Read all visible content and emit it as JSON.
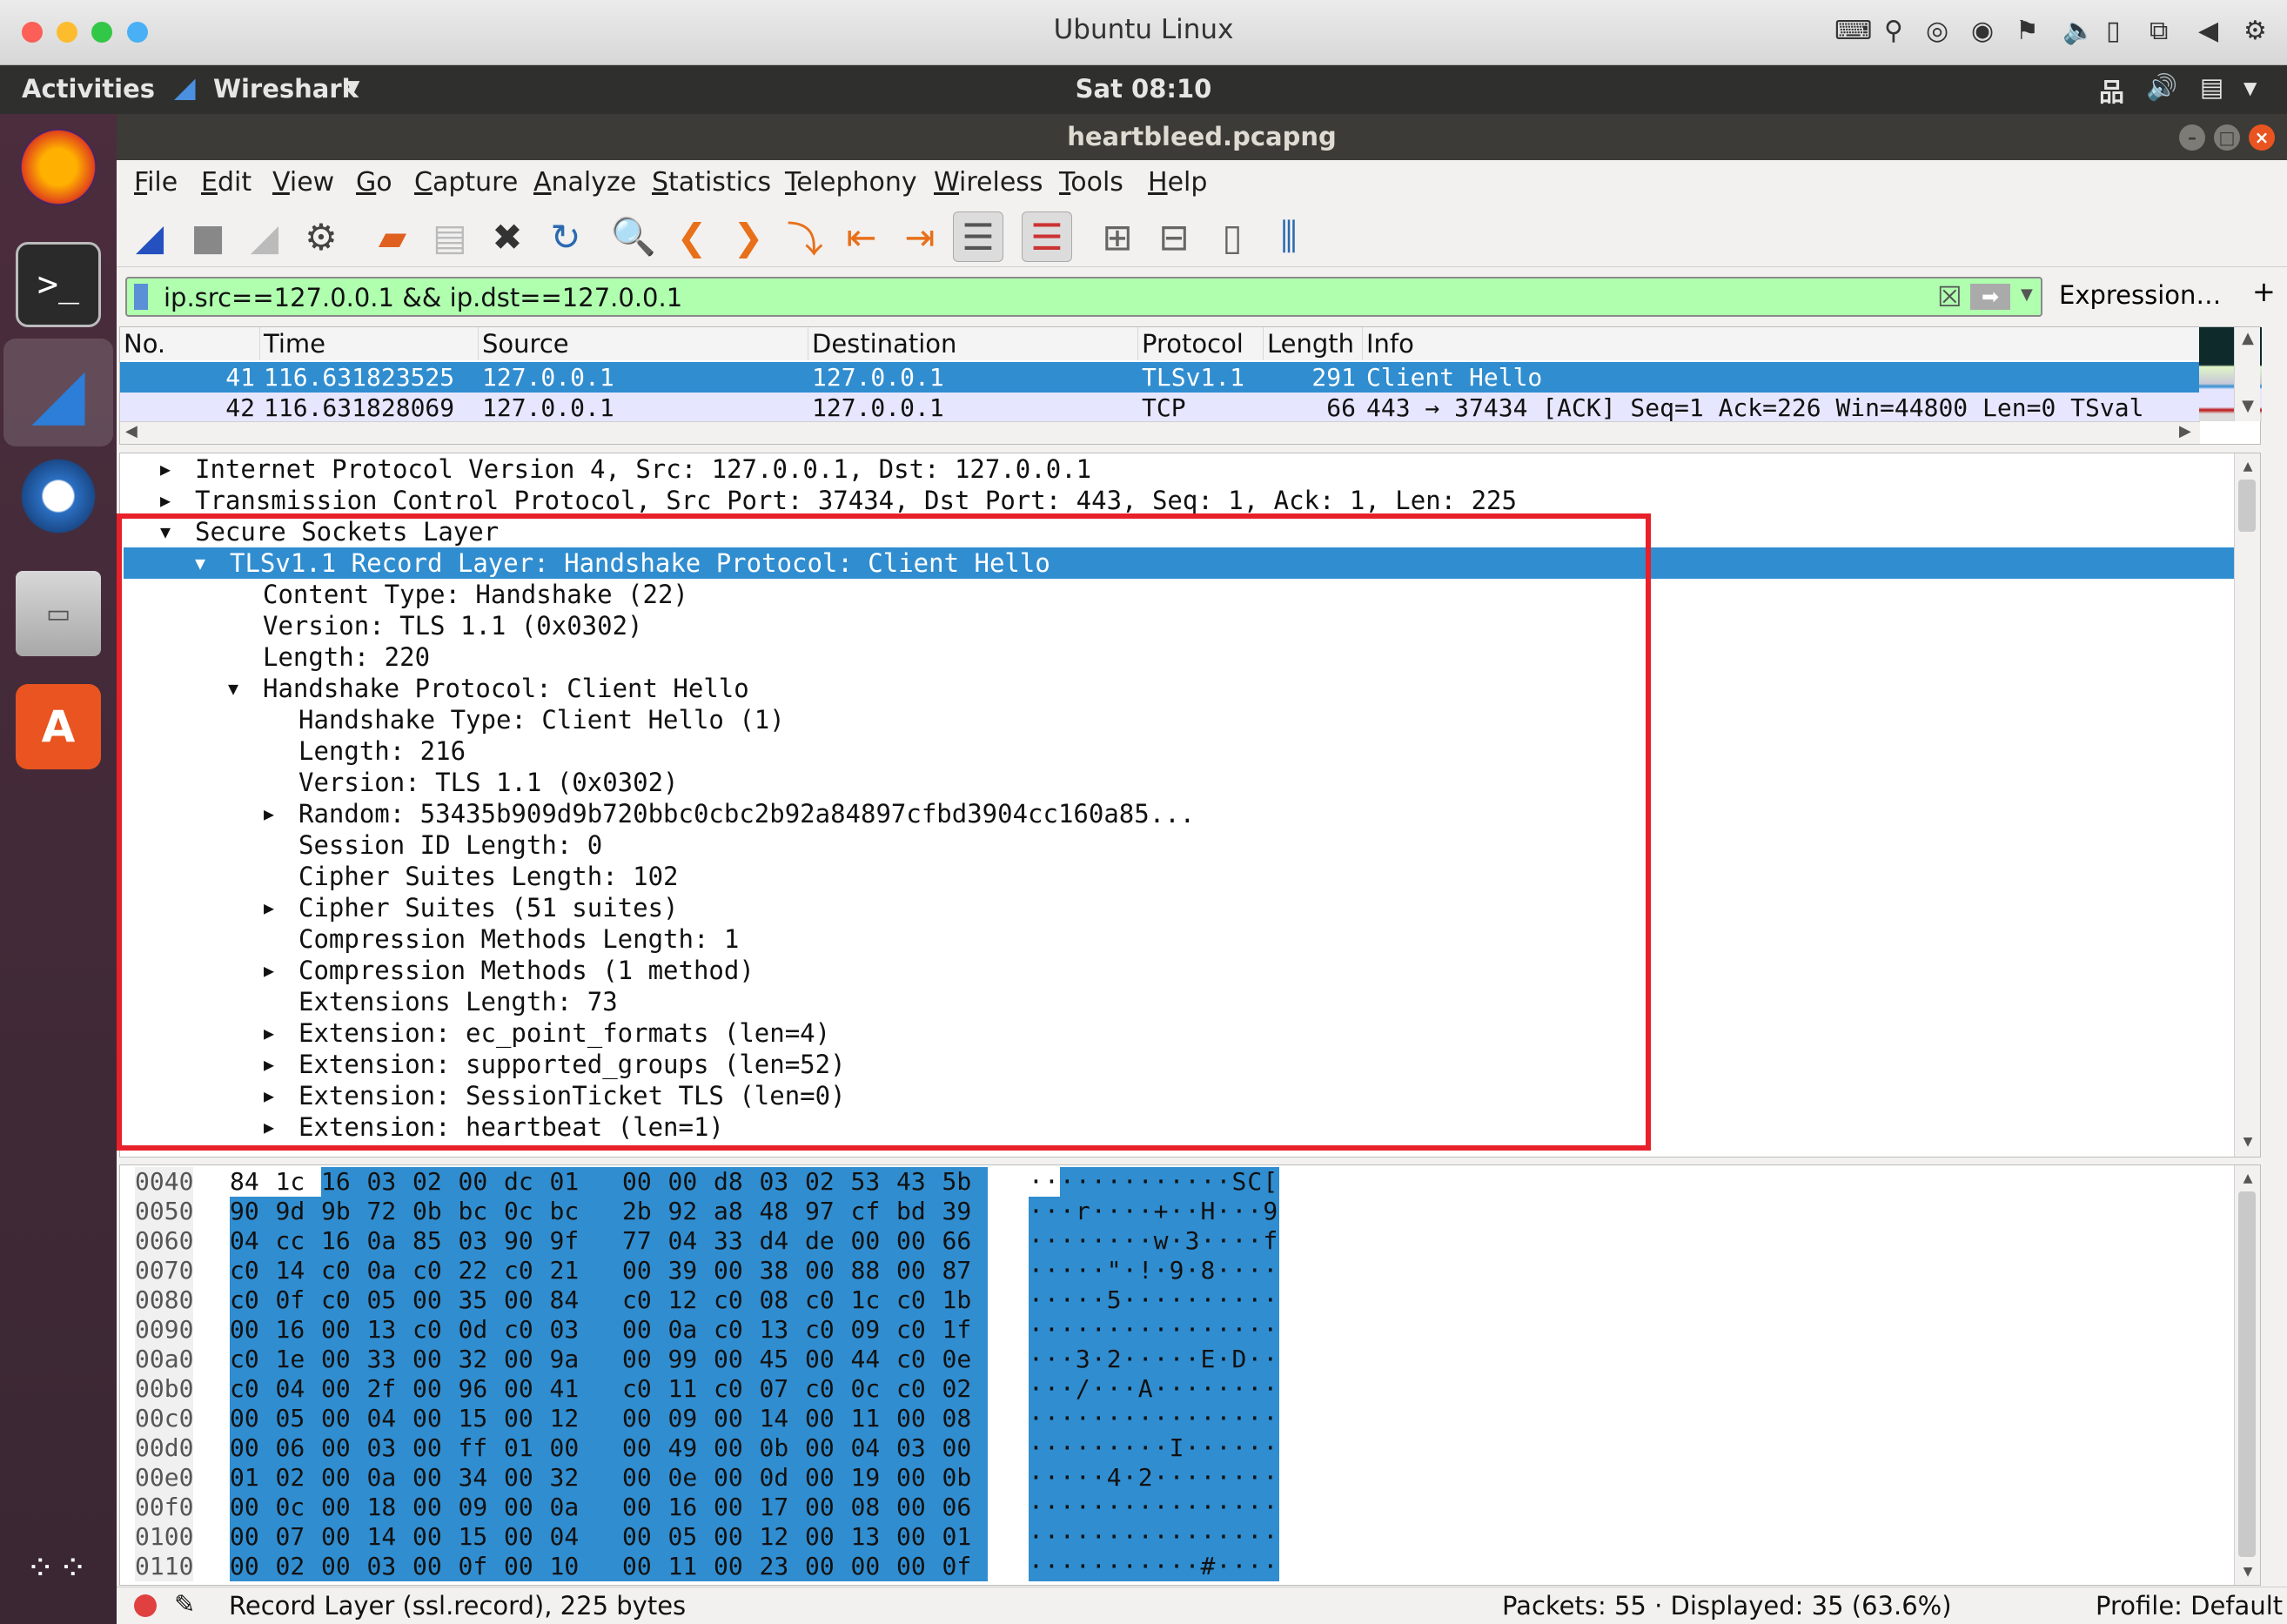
{
  "mac_window": {
    "title": "Ubuntu Linux",
    "traffic_lights": [
      "#fc5f57",
      "#fdbc2e",
      "#33c748",
      "#4ab0f5"
    ]
  },
  "top_panel": {
    "activities": "Activities",
    "app_menu": "Wireshark",
    "clock": "Sat 08:10",
    "indicators": [
      "network-icon",
      "volume-icon",
      "battery-icon",
      "menu-arrow-icon"
    ]
  },
  "launcher": [
    "firefox-icon",
    "terminal-icon",
    "wireshark-icon",
    "thunderbird-icon",
    "files-icon",
    "software-center-icon",
    "show-apps-icon"
  ],
  "window": {
    "title": "heartbleed.pcapng"
  },
  "menubar": [
    "File",
    "Edit",
    "View",
    "Go",
    "Capture",
    "Analyze",
    "Statistics",
    "Telephony",
    "Wireless",
    "Tools",
    "Help"
  ],
  "toolbar": [
    "start-capture",
    "stop-capture",
    "restart-capture",
    "capture-options",
    "open-file",
    "save-file",
    "close-file",
    "reload-file",
    "find-packet",
    "go-back",
    "go-forward",
    "go-to-packet",
    "first-packet",
    "last-packet",
    "auto-scroll",
    "colorize",
    "zoom-in",
    "zoom-out",
    "normal-size",
    "resize-columns"
  ],
  "filter": {
    "value": "ip.src==127.0.0.1 && ip.dst==127.0.0.1",
    "expression_label": "Expression…",
    "add_label": "+",
    "valid_color": "#afffaf"
  },
  "packet_list": {
    "columns": [
      "No.",
      "Time",
      "Source",
      "Destination",
      "Protocol",
      "Length",
      "Info"
    ],
    "rows": [
      {
        "no": "41",
        "time": "116.631823525",
        "source": "127.0.0.1",
        "destination": "127.0.0.1",
        "protocol": "TLSv1.1",
        "length": "291",
        "info": "Client Hello",
        "selected": true
      },
      {
        "no": "42",
        "time": "116.631828069",
        "source": "127.0.0.1",
        "destination": "127.0.0.1",
        "protocol": "TCP",
        "length": "66",
        "info": "443 → 37434 [ACK] Seq=1 Ack=226 Win=44800 Len=0 TSval",
        "selected": false
      }
    ]
  },
  "details": [
    {
      "text": "Internet Protocol Version 4, Src: 127.0.0.1, Dst: 127.0.0.1",
      "level": 0,
      "arrow": "right"
    },
    {
      "text": "Transmission Control Protocol, Src Port: 37434, Dst Port: 443, Seq: 1, Ack: 1, Len: 225",
      "level": 0,
      "arrow": "right"
    },
    {
      "text": "Secure Sockets Layer",
      "level": 0,
      "arrow": "down"
    },
    {
      "text": "TLSv1.1 Record Layer: Handshake Protocol: Client Hello",
      "level": 1,
      "arrow": "down",
      "selected": true
    },
    {
      "text": "Content Type: Handshake (22)",
      "level": 2
    },
    {
      "text": "Version: TLS 1.1 (0x0302)",
      "level": 2
    },
    {
      "text": "Length: 220",
      "level": 2
    },
    {
      "text": "Handshake Protocol: Client Hello",
      "level": 2,
      "arrow": "down"
    },
    {
      "text": "Handshake Type: Client Hello (1)",
      "level": 3
    },
    {
      "text": "Length: 216",
      "level": 3
    },
    {
      "text": "Version: TLS 1.1 (0x0302)",
      "level": 3
    },
    {
      "text": "Random: 53435b909d9b720bbc0cbc2b92a84897cfbd3904cc160a85...",
      "level": 3,
      "arrow": "right"
    },
    {
      "text": "Session ID Length: 0",
      "level": 3
    },
    {
      "text": "Cipher Suites Length: 102",
      "level": 3
    },
    {
      "text": "Cipher Suites (51 suites)",
      "level": 3,
      "arrow": "right"
    },
    {
      "text": "Compression Methods Length: 1",
      "level": 3
    },
    {
      "text": "Compression Methods (1 method)",
      "level": 3,
      "arrow": "right"
    },
    {
      "text": "Extensions Length: 73",
      "level": 3
    },
    {
      "text": "Extension: ec_point_formats (len=4)",
      "level": 3,
      "arrow": "right"
    },
    {
      "text": "Extension: supported_groups (len=52)",
      "level": 3,
      "arrow": "right"
    },
    {
      "text": "Extension: SessionTicket TLS (len=0)",
      "level": 3,
      "arrow": "right"
    },
    {
      "text": "Extension: heartbeat (len=1)",
      "level": 3,
      "arrow": "right"
    }
  ],
  "annotation": {
    "color": "#e8202a"
  },
  "hex_dump": {
    "selection_start_offset": "0042",
    "rows": [
      {
        "offset": "0040",
        "bytes": "84 1c 16 03 02 00 dc 01 00 00 d8 03 02 53 43 5b",
        "ascii": "·············SC["
      },
      {
        "offset": "0050",
        "bytes": "90 9d 9b 72 0b bc 0c bc 2b 92 a8 48 97 cf bd 39",
        "ascii": "···r····+··H···9"
      },
      {
        "offset": "0060",
        "bytes": "04 cc 16 0a 85 03 90 9f 77 04 33 d4 de 00 00 66",
        "ascii": "········w·3····f"
      },
      {
        "offset": "0070",
        "bytes": "c0 14 c0 0a c0 22 c0 21 00 39 00 38 00 88 00 87",
        "ascii": "·····\"·!·9·8····"
      },
      {
        "offset": "0080",
        "bytes": "c0 0f c0 05 00 35 00 84 c0 12 c0 08 c0 1c c0 1b",
        "ascii": "·····5··········"
      },
      {
        "offset": "0090",
        "bytes": "00 16 00 13 c0 0d c0 03 00 0a c0 13 c0 09 c0 1f",
        "ascii": "················"
      },
      {
        "offset": "00a0",
        "bytes": "c0 1e 00 33 00 32 00 9a 00 99 00 45 00 44 c0 0e",
        "ascii": "···3·2·····E·D··"
      },
      {
        "offset": "00b0",
        "bytes": "c0 04 00 2f 00 96 00 41 c0 11 c0 07 c0 0c c0 02",
        "ascii": "···/···A········"
      },
      {
        "offset": "00c0",
        "bytes": "00 05 00 04 00 15 00 12 00 09 00 14 00 11 00 08",
        "ascii": "················"
      },
      {
        "offset": "00d0",
        "bytes": "00 06 00 03 00 ff 01 00 00 49 00 0b 00 04 03 00",
        "ascii": "·········I······"
      },
      {
        "offset": "00e0",
        "bytes": "01 02 00 0a 00 34 00 32 00 0e 00 0d 00 19 00 0b",
        "ascii": "·····4·2········"
      },
      {
        "offset": "00f0",
        "bytes": "00 0c 00 18 00 09 00 0a 00 16 00 17 00 08 00 06",
        "ascii": "················"
      },
      {
        "offset": "0100",
        "bytes": "00 07 00 14 00 15 00 04 00 05 00 12 00 13 00 01",
        "ascii": "················"
      },
      {
        "offset": "0110",
        "bytes": "00 02 00 03 00 0f 00 10 00 11 00 23 00 00 00 0f",
        "ascii": "···········#····"
      }
    ]
  },
  "statusbar": {
    "field": "Record Layer (ssl.record), 225 bytes",
    "packets": "Packets: 55 · Displayed: 35 (63.6%)",
    "profile": "Profile: Default"
  },
  "selection_color": "#308dd0"
}
